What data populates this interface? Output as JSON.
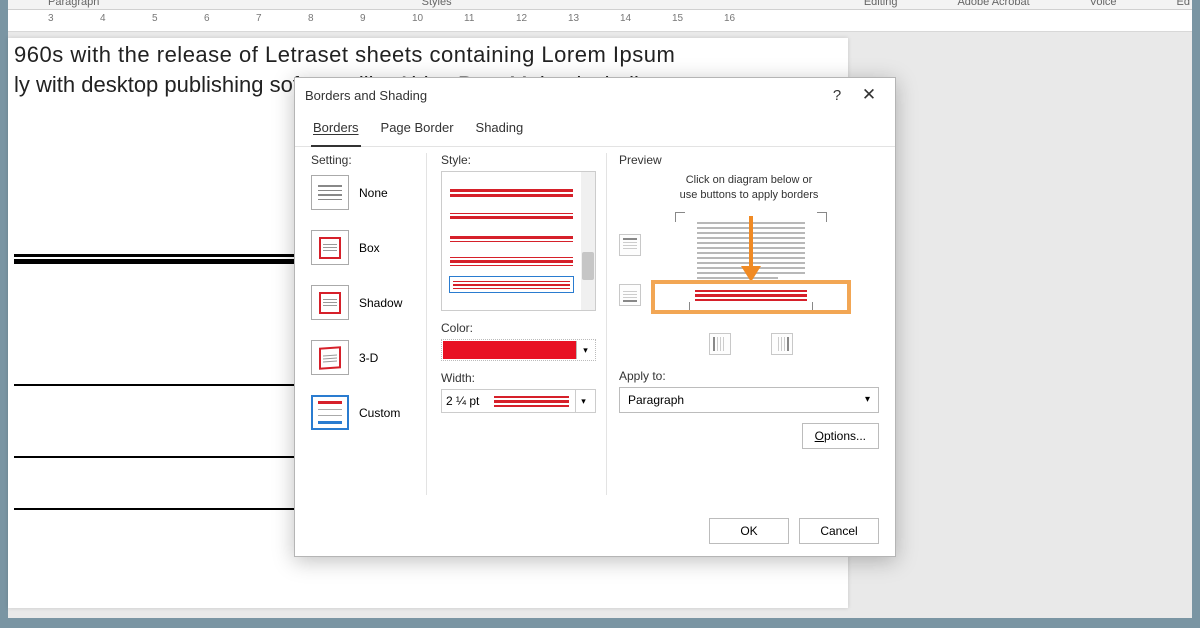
{
  "ribbon": {
    "items": [
      "Paragraph",
      "Styles",
      "Editing",
      "Adobe Acrobat",
      "Voice",
      "Ed"
    ]
  },
  "ruler": {
    "marks": [
      "3",
      "4",
      "5",
      "6",
      "7",
      "8",
      "9",
      "10",
      "11",
      "12",
      "13",
      "14",
      "15",
      "16"
    ]
  },
  "document": {
    "line1": "960s with the release of Letraset sheets containing Lorem Ipsum",
    "line2": "ly with desktop publishing software like Aldus PageMaker including"
  },
  "dialog": {
    "title": "Borders and Shading",
    "help": "?",
    "close": "✕",
    "tabs": {
      "borders": "Borders",
      "page_border": "Page Border",
      "shading": "Shading"
    },
    "setting": {
      "label": "Setting:",
      "none": "None",
      "box": "Box",
      "shadow": "Shadow",
      "three_d": "3-D",
      "custom": "Custom"
    },
    "style": {
      "label": "Style:"
    },
    "color": {
      "label": "Color:",
      "value": "#e81123"
    },
    "width": {
      "label": "Width:",
      "value": "2 ¼ pt"
    },
    "preview": {
      "label": "Preview",
      "hint1": "Click on diagram below or",
      "hint2": "use buttons to apply borders"
    },
    "apply": {
      "label": "Apply to:",
      "value": "Paragraph"
    },
    "options": "Options...",
    "ok": "OK",
    "cancel": "Cancel"
  }
}
